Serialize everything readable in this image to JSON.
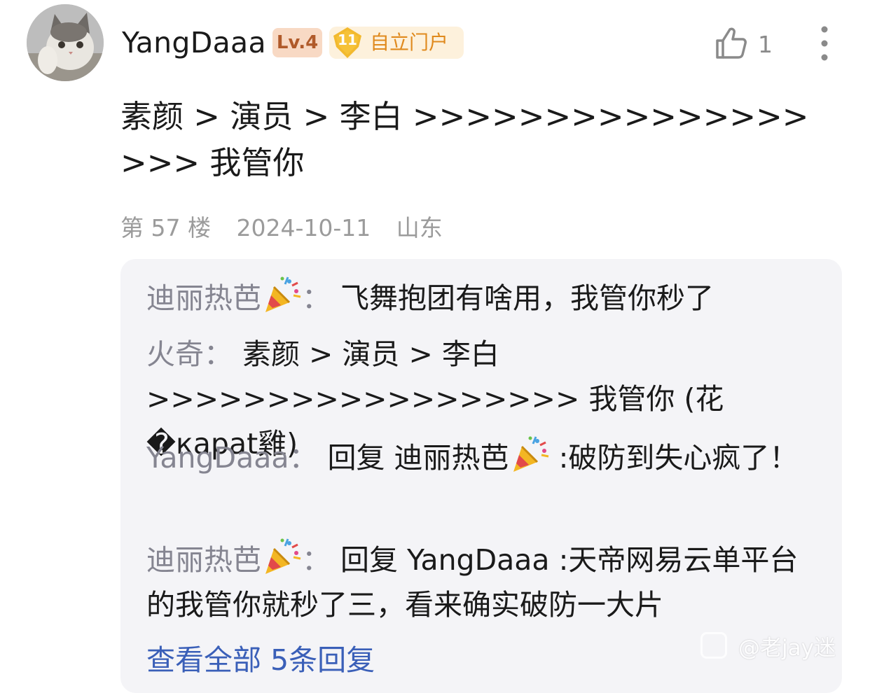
{
  "comment": {
    "user": {
      "name": "YangDaaa",
      "level": "Lv.4",
      "fan_badge_level": "11",
      "fan_badge_name": "自立门户"
    },
    "likes": "1",
    "text": "素颜 > 演员 > 李白 >>>>>>>>>>>>>>>>>> 我管你",
    "floor": "第 57 楼",
    "date": "2024-10-11",
    "location": "山东"
  },
  "replies": [
    {
      "author": "迪丽热芭",
      "author_emoji": "party-popper-icon",
      "separator": "：",
      "text": "飞舞抱团有啥用，我管你秒了"
    },
    {
      "author": "火奇",
      "separator": "：",
      "text": "素颜 > 演员 > 李白 >>>>>>>>>>>>>>>>>> 我管你 (花�караt雞)"
    },
    {
      "author": "YangDaaa",
      "separator": "：",
      "reply_prefix": "回复",
      "reply_target": "迪丽热芭",
      "target_emoji": "party-popper-icon",
      "text": ":破防到失心疯了！"
    },
    {
      "author": "迪丽热芭",
      "author_emoji": "party-popper-icon",
      "separator": "：",
      "reply_prefix": "回复",
      "reply_target": "YangDaaa",
      "text": ":天帝网易云单平台的我管你就秒了三，看来确实破防一大片"
    }
  ],
  "see_all_label": "查看全部 5条回复",
  "watermark": "@老jay迷",
  "colors": {
    "username": "#1a1a1a",
    "reply_author": "#858591",
    "meta": "#9b9b9b",
    "link": "#3a5fb8",
    "reply_bg": "#f4f4f7",
    "level_badge_bg": "#f8d9c4",
    "level_badge_text": "#b05a2a",
    "fan_badge_bg": "#fdf1dc",
    "fan_badge_text": "#e08a1e"
  }
}
